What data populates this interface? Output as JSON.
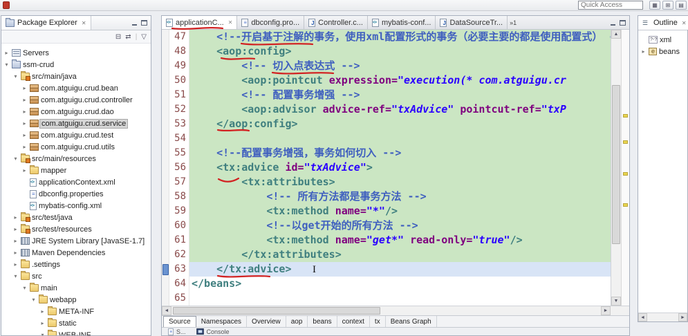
{
  "window": {
    "quick_access_placeholder": "Quick Access"
  },
  "package_explorer": {
    "title": "Package Explorer",
    "tree": [
      {
        "label": "Servers",
        "level": 0,
        "arrow": "c",
        "icon": "server"
      },
      {
        "label": "ssm-crud",
        "level": 0,
        "arrow": "e",
        "icon": "project"
      },
      {
        "label": "src/main/java",
        "level": 1,
        "arrow": "e",
        "icon": "srcfolder"
      },
      {
        "label": "com.atguigu.crud.bean",
        "level": 2,
        "arrow": "c",
        "icon": "package"
      },
      {
        "label": "com.atguigu.crud.controller",
        "level": 2,
        "arrow": "c",
        "icon": "package"
      },
      {
        "label": "com.atguigu.crud.dao",
        "level": 2,
        "arrow": "c",
        "icon": "package"
      },
      {
        "label": "com.atguigu.crud.service",
        "level": 2,
        "arrow": "c",
        "icon": "package",
        "selected": true
      },
      {
        "label": "com.atguigu.crud.test",
        "level": 2,
        "arrow": "c",
        "icon": "package"
      },
      {
        "label": "com.atguigu.crud.utils",
        "level": 2,
        "arrow": "c",
        "icon": "package"
      },
      {
        "label": "src/main/resources",
        "level": 1,
        "arrow": "e",
        "icon": "srcfolder"
      },
      {
        "label": "mapper",
        "level": 2,
        "arrow": "c",
        "icon": "folder"
      },
      {
        "label": "applicationContext.xml",
        "level": 2,
        "arrow": "n",
        "icon": "xmlfile"
      },
      {
        "label": "dbconfig.properties",
        "level": 2,
        "arrow": "n",
        "icon": "propfile"
      },
      {
        "label": "mybatis-config.xml",
        "level": 2,
        "arrow": "n",
        "icon": "xmlfile"
      },
      {
        "label": "src/test/java",
        "level": 1,
        "arrow": "c",
        "icon": "srcfolder"
      },
      {
        "label": "src/test/resources",
        "level": 1,
        "arrow": "c",
        "icon": "srcfolder"
      },
      {
        "label": "JRE System Library [JavaSE-1.7]",
        "level": 1,
        "arrow": "c",
        "icon": "library"
      },
      {
        "label": "Maven Dependencies",
        "level": 1,
        "arrow": "c",
        "icon": "library"
      },
      {
        "label": ".settings",
        "level": 1,
        "arrow": "c",
        "icon": "folder"
      },
      {
        "label": "src",
        "level": 1,
        "arrow": "e",
        "icon": "folder"
      },
      {
        "label": "main",
        "level": 2,
        "arrow": "e",
        "icon": "folder"
      },
      {
        "label": "webapp",
        "level": 3,
        "arrow": "e",
        "icon": "folder"
      },
      {
        "label": "META-INF",
        "level": 4,
        "arrow": "c",
        "icon": "folder"
      },
      {
        "label": "static",
        "level": 4,
        "arrow": "c",
        "icon": "folder"
      },
      {
        "label": "WEB-INF",
        "level": 4,
        "arrow": "e",
        "icon": "folder"
      }
    ]
  },
  "editor": {
    "tabs": [
      {
        "label": "applicationC...",
        "icon": "xmlfile",
        "active": true
      },
      {
        "label": "dbconfig.pro...",
        "icon": "propfile",
        "active": false
      },
      {
        "label": "Controller.c...",
        "icon": "javafile",
        "active": false
      },
      {
        "label": "mybatis-conf...",
        "icon": "xmlfile",
        "active": false
      },
      {
        "label": "DataSourceTr...",
        "icon": "javafile",
        "active": false
      }
    ],
    "tab_overflow": "»1",
    "current_line": 63,
    "ruler_marks": [
      122,
      160,
      206,
      251
    ],
    "lines": [
      {
        "n": 47,
        "bg": "green",
        "seg": [
          [
            "cm",
            "    <!--开启基于注解的事务，使用xml配置形式的事务（必要主要的都是使用配置式） -->"
          ]
        ]
      },
      {
        "n": 48,
        "bg": "green",
        "seg": [
          [
            "tg",
            "    <aop:config>"
          ]
        ]
      },
      {
        "n": 49,
        "bg": "green",
        "seg": [
          [
            "cm",
            "        <!-- 切入点表达式 -->"
          ]
        ]
      },
      {
        "n": 50,
        "bg": "green",
        "seg": [
          [
            "tg",
            "        <aop:pointcut "
          ],
          [
            "at",
            "expression="
          ],
          [
            "vl",
            "\"execution(* com.atguigu.cr"
          ]
        ]
      },
      {
        "n": 51,
        "bg": "green",
        "seg": [
          [
            "cm",
            "        <!-- 配置事务增强 -->"
          ]
        ]
      },
      {
        "n": 52,
        "bg": "green",
        "seg": [
          [
            "tg",
            "        <aop:advisor "
          ],
          [
            "at",
            "advice-ref="
          ],
          [
            "vl",
            "\"txAdvice\""
          ],
          [
            "tg",
            " "
          ],
          [
            "at",
            "pointcut-ref="
          ],
          [
            "vl",
            "\"txP"
          ]
        ]
      },
      {
        "n": 53,
        "bg": "green",
        "seg": [
          [
            "tg",
            "    </aop:config>"
          ]
        ]
      },
      {
        "n": 54,
        "bg": "green",
        "seg": []
      },
      {
        "n": 55,
        "bg": "green",
        "seg": [
          [
            "cm",
            "    <!--配置事务增强，事务如何切入 -->"
          ]
        ]
      },
      {
        "n": 56,
        "bg": "green",
        "seg": [
          [
            "tg",
            "    <tx:advice "
          ],
          [
            "at",
            "id="
          ],
          [
            "vl",
            "\"txAdvice\""
          ],
          [
            "tg",
            ">"
          ]
        ]
      },
      {
        "n": 57,
        "bg": "green",
        "seg": [
          [
            "tg",
            "        <tx:attributes>"
          ]
        ]
      },
      {
        "n": 58,
        "bg": "green",
        "seg": [
          [
            "cm",
            "            <!-- 所有方法都是事务方法 -->"
          ]
        ]
      },
      {
        "n": 59,
        "bg": "green",
        "seg": [
          [
            "tg",
            "            <tx:method "
          ],
          [
            "at",
            "name="
          ],
          [
            "vl",
            "\"*\""
          ],
          [
            "tg",
            "/>"
          ]
        ]
      },
      {
        "n": 60,
        "bg": "green",
        "seg": [
          [
            "cm",
            "            <!--以get开始的所有方法 -->"
          ]
        ]
      },
      {
        "n": 61,
        "bg": "green",
        "seg": [
          [
            "tg",
            "            <tx:method "
          ],
          [
            "at",
            "name="
          ],
          [
            "vl",
            "\"get*\""
          ],
          [
            "tg",
            " "
          ],
          [
            "at",
            "read-only="
          ],
          [
            "vl",
            "\"true\""
          ],
          [
            "tg",
            "/>"
          ]
        ]
      },
      {
        "n": 62,
        "bg": "green",
        "seg": [
          [
            "tg",
            "        </tx:attributes>"
          ]
        ]
      },
      {
        "n": 63,
        "bg": "current",
        "seg": [
          [
            "tg",
            "    </tx:advice>"
          ]
        ]
      },
      {
        "n": 64,
        "bg": "plain",
        "seg": [
          [
            "tg",
            "</beans>"
          ]
        ]
      },
      {
        "n": 65,
        "bg": "plain",
        "seg": []
      }
    ],
    "bottom_tabs": [
      {
        "label": "Source",
        "active": true
      },
      {
        "label": "Namespaces",
        "active": false
      },
      {
        "label": "Overview",
        "active": false
      },
      {
        "label": "aop",
        "active": false
      },
      {
        "label": "beans",
        "active": false
      },
      {
        "label": "context",
        "active": false
      },
      {
        "label": "tx",
        "active": false
      },
      {
        "label": "Beans Graph",
        "active": false
      }
    ]
  },
  "outline": {
    "title": "Outline",
    "items": [
      {
        "label": "xml",
        "icon": "xmldecl",
        "arrow": false
      },
      {
        "label": "beans",
        "icon": "element",
        "arrow": true
      }
    ]
  },
  "console_bar": {
    "tabs": [
      {
        "label": "S...",
        "icon": "propfile"
      },
      {
        "label": "Console",
        "icon": "console"
      }
    ]
  },
  "colors": {
    "coverage_green": "#cbe6c3",
    "current_line_blue": "#d8e4f6",
    "annotation_red": "#d22222",
    "tag_teal": "#3f7f7f",
    "attr_purple": "#7f007f",
    "value_blue": "#2a00ff",
    "comment_blue": "#3f5fbf",
    "occurrence_yellow": "#ead64f"
  }
}
